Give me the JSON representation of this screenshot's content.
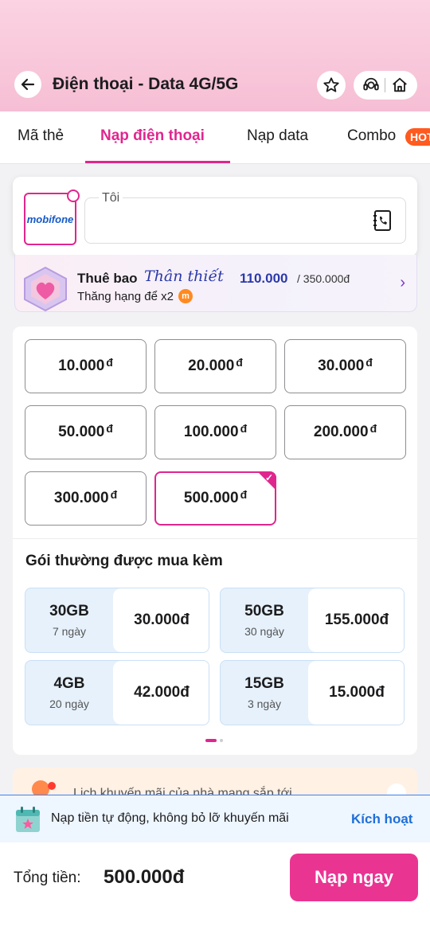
{
  "header": {
    "title": "Điện thoại - Data 4G/5G"
  },
  "tabs": [
    {
      "label": "Mã thẻ"
    },
    {
      "label": "Nạp điện thoại"
    },
    {
      "label": "Nạp data"
    },
    {
      "label": "Combo"
    }
  ],
  "hot_badge": "HOT",
  "phone": {
    "carrier_logo_text": "mobifone",
    "label": "Tôi",
    "value": ""
  },
  "loyalty": {
    "title": "Thuê bao",
    "tier": "Thân thiết",
    "points": "110.000",
    "total": "/ 350.000đ",
    "subtitle": "Thăng hạng để x2",
    "coin": "m"
  },
  "amounts": [
    {
      "value": "10.000",
      "currency": "đ"
    },
    {
      "value": "20.000",
      "currency": "đ"
    },
    {
      "value": "30.000",
      "currency": "đ"
    },
    {
      "value": "50.000",
      "currency": "đ"
    },
    {
      "value": "100.000",
      "currency": "đ"
    },
    {
      "value": "200.000",
      "currency": "đ"
    },
    {
      "value": "300.000",
      "currency": "đ"
    },
    {
      "value": "500.000",
      "currency": "đ",
      "selected": true
    }
  ],
  "bundles": {
    "heading": "Gói thường được mua kèm",
    "items": [
      {
        "data": "30GB",
        "days": "7 ngày",
        "price": "30.000đ"
      },
      {
        "data": "50GB",
        "days": "30 ngày",
        "price": "155.000đ"
      },
      {
        "data": "4GB",
        "days": "20 ngày",
        "price": "42.000đ"
      },
      {
        "data": "15GB",
        "days": "3 ngày",
        "price": "15.000đ"
      }
    ]
  },
  "promo": {
    "text": "Lịch khuyến mãi của nhà mạng sắp tới"
  },
  "autopay": {
    "text": "Nạp tiền tự động, không bỏ lỡ khuyến mãi",
    "action": "Kích hoạt"
  },
  "footer": {
    "total_label": "Tổng tiền:",
    "total_value": "500.000đ",
    "pay_label": "Nạp ngay"
  },
  "colors": {
    "accent": "#e0268e",
    "button": "#ea3492",
    "link": "#1e6fd9",
    "hot": "#ff5a1f"
  },
  "icons": [
    "back-arrow-icon",
    "star-icon",
    "support-agent-icon",
    "home-icon",
    "contacts-book-icon",
    "chevron-right-icon",
    "check-icon",
    "calendar-icon",
    "bell-icon",
    "chevron-up-icon"
  ]
}
